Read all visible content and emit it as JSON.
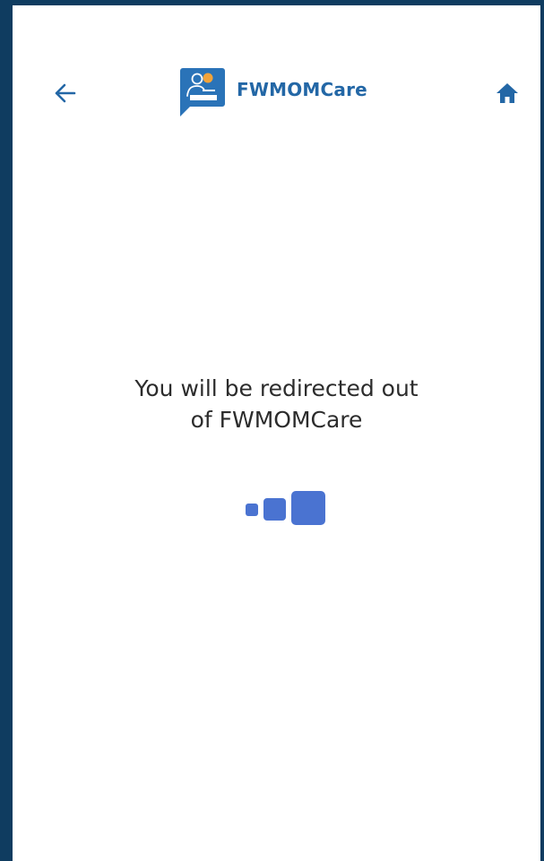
{
  "app": {
    "name": "FWMOMCare",
    "brand_color": "#2367a6",
    "frame_color": "#0f3c60",
    "loader_color": "#4a73d1"
  },
  "header": {
    "back_icon": "arrow-left-icon",
    "logo_icon": "person-speech-bubble-icon",
    "home_icon": "home-icon"
  },
  "message": {
    "line1": "You will be redirected out",
    "line2": "of FWMOMCare"
  },
  "loader": {
    "icon": "loading-squares-icon"
  }
}
